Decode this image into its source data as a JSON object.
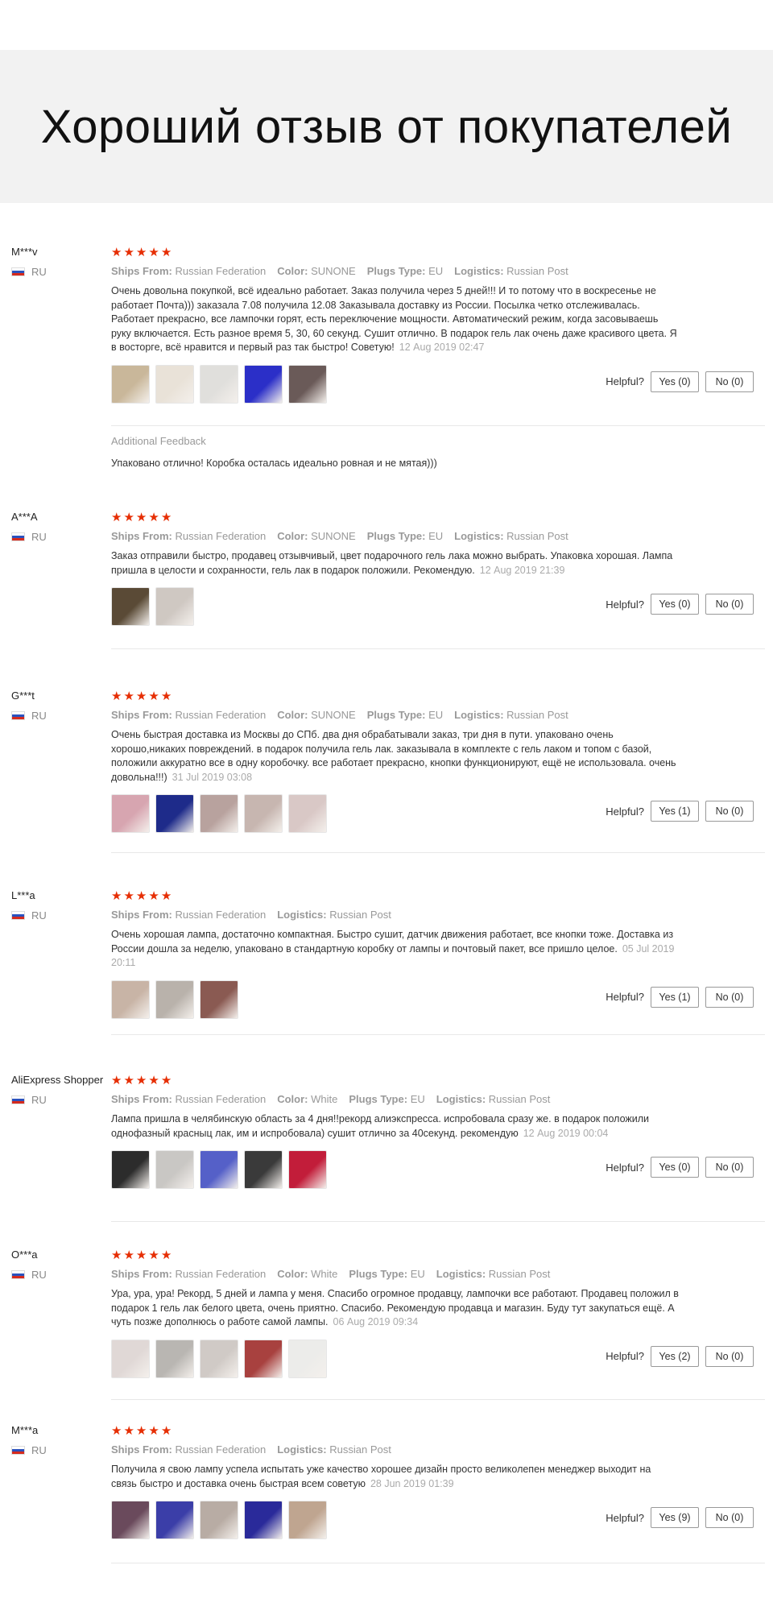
{
  "banner": {
    "title": "Хороший отзыв от покупателей"
  },
  "labels": {
    "ships_from": "Ships From:",
    "color": "Color:",
    "plugs": "Plugs Type:",
    "logistics": "Logistics:",
    "helpful": "Helpful?",
    "additional_feedback": "Additional Feedback"
  },
  "star_color": "#e62e04",
  "reviews": [
    {
      "user": "M***v",
      "country": "RU",
      "rating": 5,
      "ships_from": "Russian Federation",
      "color": "SUNONE",
      "plugs": "EU",
      "logistics": "Russian Post",
      "text": "Очень довольна покупкой, всё идеально работает. Заказ получила через 5 дней!!! И то потому что в воскресенье не работает Почта))) заказала 7.08 получила 12.08 Заказывала доставку из России. Посылка четко отслеживалась. Работает прекрасно, все лампочки горят, есть переключение мощности. Автоматический режим, когда засовываешь руку включается. Есть разное время 5, 30, 60 секунд. Сушит отлично. В подарок гель лак очень даже красивого цвета. Я в восторге, всё нравится и первый раз так быстро! Советую!",
      "date": "12 Aug 2019 02:47",
      "yes": "Yes (0)",
      "no": "No (0)",
      "additional": "Упаковано отлично! Коробка осталась идеально ровная и не мятая)))"
    },
    {
      "user": "A***A",
      "country": "RU",
      "rating": 5,
      "ships_from": "Russian Federation",
      "color": "SUNONE",
      "plugs": "EU",
      "logistics": "Russian Post",
      "text": "Заказ отправили быстро, продавец отзывчивый, цвет подарочного гель лака можно выбрать. Упаковка хорошая. Лампа пришла в целости и сохранности, гель лак в подарок положили. Рекомендую.",
      "date": "12 Aug 2019 21:39",
      "yes": "Yes (0)",
      "no": "No (0)"
    },
    {
      "user": "G***t",
      "country": "RU",
      "rating": 5,
      "ships_from": "Russian Federation",
      "color": "SUNONE",
      "plugs": "EU",
      "logistics": "Russian Post",
      "text": "Очень быстрая доставка из Москвы до СПб. два дня обрабатывали заказ, три дня в пути. упаковано очень хорошо,никаких повреждений. в подарок получила гель лак. заказывала в комплекте с гель лаком и топом с базой, положили аккуратно все в одну коробочку. все работает прекрасно, кнопки функционируют, ещё не использовала. очень довольна!!!)",
      "date": "31 Jul 2019 03:08",
      "yes": "Yes (1)",
      "no": "No (0)"
    },
    {
      "user": "L***a",
      "country": "RU",
      "rating": 5,
      "ships_from": "Russian Federation",
      "logistics": "Russian Post",
      "text": "Очень хорошая лампа, достаточно компактная. Быстро сушит, датчик движения работает, все кнопки тоже. Доставка из России дошла за неделю, упаковано в стандартную коробку от лампы и почтовый пакет, все пришло целое.",
      "date": "05 Jul 2019 20:11",
      "yes": "Yes (1)",
      "no": "No (0)"
    },
    {
      "user": "AliExpress Shopper",
      "country": "RU",
      "rating": 5,
      "ships_from": "Russian Federation",
      "color": "White",
      "plugs": "EU",
      "logistics": "Russian Post",
      "text": "Лампа пришла в челябинскую область за 4 дня!!рекорд алиэкспресса. испробовала сразу же. в подарок положили однофазный красныц лак, им и испробовала) сушит отлично за 40секунд. рекомендую",
      "date": "12 Aug 2019 00:04",
      "yes": "Yes (0)",
      "no": "No (0)"
    },
    {
      "user": "O***a",
      "country": "RU",
      "rating": 5,
      "ships_from": "Russian Federation",
      "color": "White",
      "plugs": "EU",
      "logistics": "Russian Post",
      "text": "Ура, ура, ура! Рекорд, 5 дней и лампа у меня. Спасибо огромное продавцу, лампочки все работают. Продавец положил в подарок 1 гель лак белого цвета, очень приятно. Спасибо. Рекомендую продавца и магазин. Буду тут закупаться ещё. А чуть позже дополнюсь о работе самой лампы.",
      "date": "06 Aug 2019 09:34",
      "yes": "Yes (2)",
      "no": "No (0)"
    },
    {
      "user": "M***a",
      "country": "RU",
      "rating": 5,
      "ships_from": "Russian Federation",
      "logistics": "Russian Post",
      "text": "Получила я свою лампу успела испытать уже качество хорошее дизайн просто великолепен менеджер выходит на связь быстро и доставка очень быстрая всем советую",
      "date": "28 Jun 2019 01:39",
      "yes": "Yes (9)",
      "no": "No (0)"
    }
  ]
}
